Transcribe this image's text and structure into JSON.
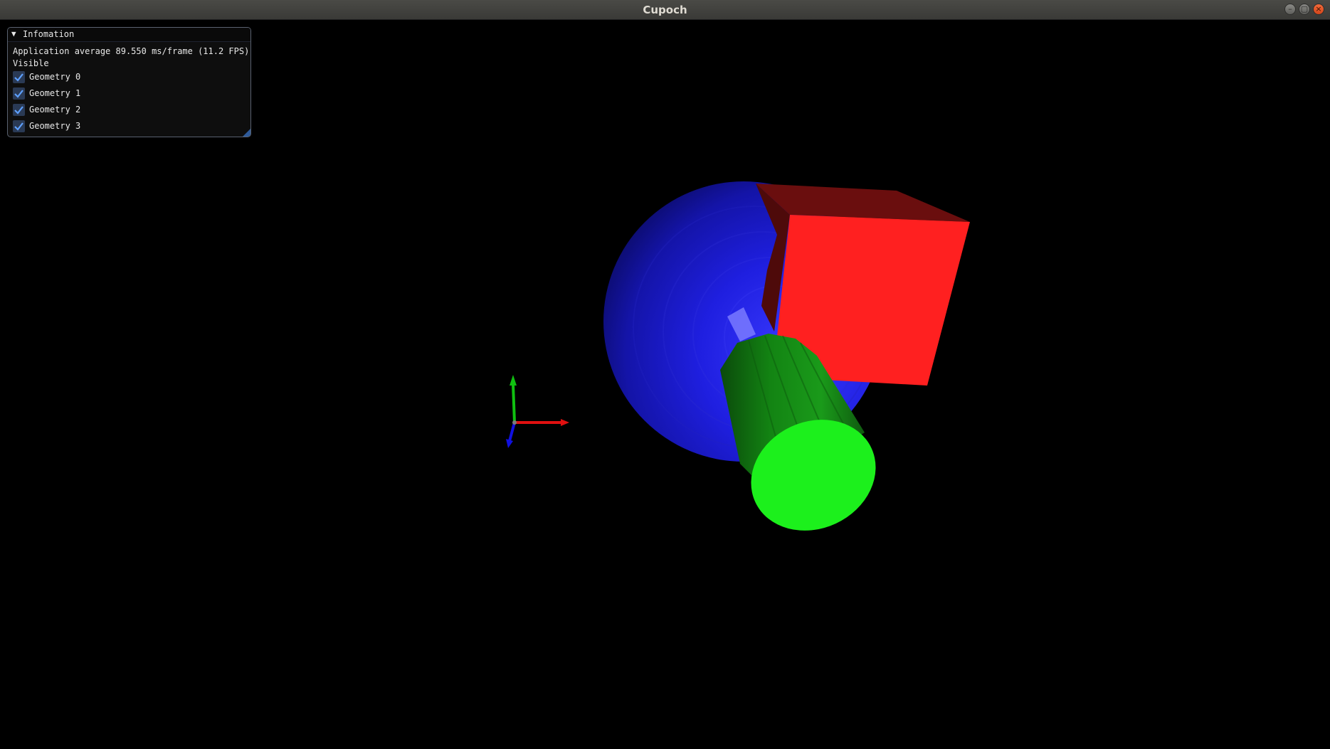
{
  "window": {
    "title": "Cupoch",
    "controls": {
      "minimize_icon": "–",
      "maximize_icon": "▢",
      "close_icon": "×"
    }
  },
  "info_panel": {
    "collapse_icon": "▼",
    "title": "Infomation",
    "fps_text": "Application average 89.550 ms/frame (11.2 FPS)",
    "visible_label": "Visible",
    "geometries": [
      {
        "label": "Geometry 0",
        "checked": true
      },
      {
        "label": "Geometry 1",
        "checked": true
      },
      {
        "label": "Geometry 2",
        "checked": true
      },
      {
        "label": "Geometry 3",
        "checked": true
      }
    ]
  },
  "scene": {
    "background": "#000000",
    "sphere_color": "#1a1ad8",
    "box_color": "#ff2020",
    "cylinder_color": "#1cf01c",
    "axis_colors": {
      "x": "#e01010",
      "y": "#10c010",
      "z": "#1010e0"
    }
  }
}
